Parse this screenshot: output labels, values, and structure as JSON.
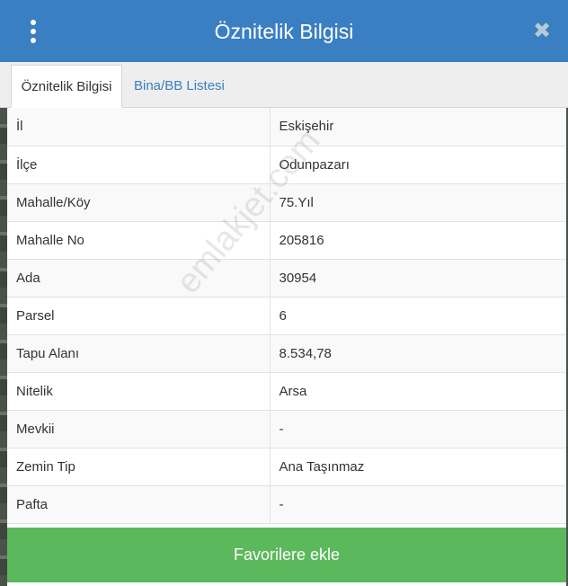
{
  "header": {
    "title": "Öznitelik Bilgisi",
    "menu_icon": "vertical-ellipsis-icon",
    "close_glyph": "✖",
    "color": "#3a7fc1"
  },
  "tabs": [
    {
      "label": "Öznitelik Bilgisi",
      "active": true
    },
    {
      "label": "Bina/BB Listesi",
      "active": false
    }
  ],
  "rows": [
    {
      "label": "İl",
      "value": "Eskişehir"
    },
    {
      "label": "İlçe",
      "value": "Odunpazarı"
    },
    {
      "label": "Mahalle/Köy",
      "value": "75.Yıl"
    },
    {
      "label": "Mahalle No",
      "value": "205816"
    },
    {
      "label": "Ada",
      "value": "30954"
    },
    {
      "label": "Parsel",
      "value": "6"
    },
    {
      "label": "Tapu Alanı",
      "value": "8.534,78"
    },
    {
      "label": "Nitelik",
      "value": "Arsa"
    },
    {
      "label": "Mevkii",
      "value": "-"
    },
    {
      "label": "Zemin Tip",
      "value": "Ana Taşınmaz"
    },
    {
      "label": "Pafta",
      "value": "-"
    }
  ],
  "watermark": "emlakjet.com",
  "footer": {
    "button_label": "Favorilere ekle",
    "color": "#5cb85c"
  }
}
